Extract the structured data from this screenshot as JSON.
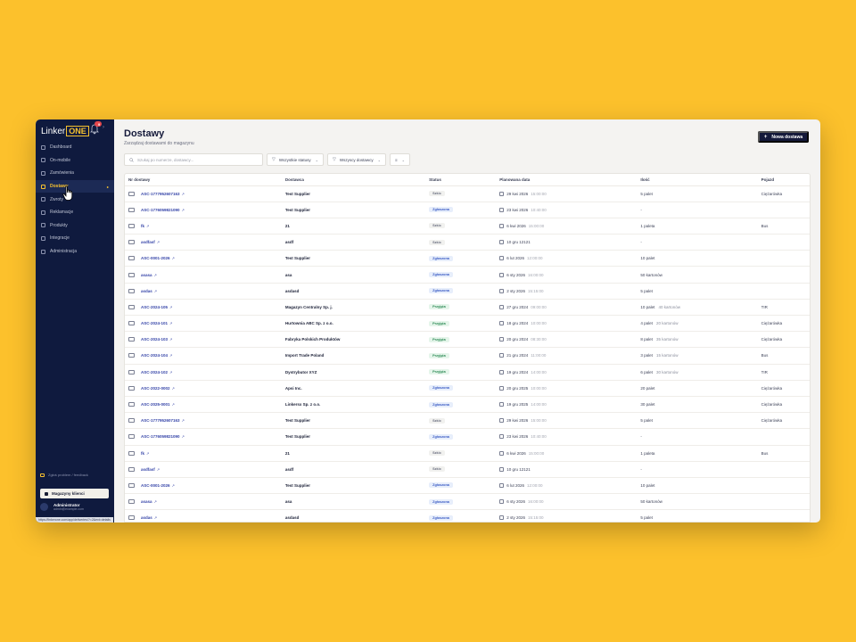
{
  "sidebar": {
    "logo_text": "Linker",
    "logo_box": "ONE",
    "notifications_count": "9",
    "nav": [
      {
        "label": "Dashboard",
        "icon": "grid-icon",
        "active": false
      },
      {
        "label": "On-mobile",
        "icon": "phone-icon",
        "active": false
      },
      {
        "label": "Zamówienia",
        "icon": "cart-icon",
        "active": false
      },
      {
        "label": "Dostawy",
        "icon": "truck-icon",
        "active": true
      },
      {
        "label": "Zwroty",
        "icon": "return-icon",
        "active": false
      },
      {
        "label": "Reklamacje",
        "icon": "alert-icon",
        "active": false
      },
      {
        "label": "Produkty",
        "icon": "box-icon",
        "active": false
      },
      {
        "label": "Integracje",
        "icon": "plug-icon",
        "active": false
      },
      {
        "label": "Administracja",
        "icon": "gear-icon",
        "active": false
      }
    ],
    "bottom_link": "Zgłoś problem / feedback",
    "warehouse_btn": "Magazyny klienci",
    "user_name": "Administrator",
    "user_email": "admin@example.com",
    "url_tooltip": "https://linkerone.com/app/deliveries/?=2&ext=details"
  },
  "header": {
    "title": "Dostawy",
    "subtitle": "Zarządzaj dostawami do magazynu",
    "new_button": "Nowa dostawa"
  },
  "filters": {
    "search_placeholder": "Szukaj po numerze, dostawcy...",
    "status_filter": "Wszystkie statusy",
    "supplier_filter": "Wszyscy dostawcy",
    "view_toggle": "≡"
  },
  "table": {
    "columns": [
      "Nr dostawy",
      "Dostawca",
      "Status",
      "Planowana data",
      "Ilość",
      "Pojazd"
    ],
    "rows": [
      {
        "id": "ASC-1777952607163",
        "supplier": "Test Supplier",
        "status": "Szkic",
        "status_type": "szkic",
        "date": "29 kwi 2026",
        "time": "15:00:00",
        "qty": "5 palet",
        "qty2": "",
        "vehicle": "Ciężarówka"
      },
      {
        "id": "ASC-1776059821090",
        "supplier": "Test Supplier",
        "status": "Zgłoszona",
        "status_type": "zgl",
        "date": "23 kwi 2026",
        "time": "10:40:00",
        "qty": "-",
        "qty2": "",
        "vehicle": ""
      },
      {
        "id": "fk",
        "supplier": "21",
        "status": "Szkic",
        "status_type": "szkic",
        "date": "6 kwi 2026",
        "time": "15:00:00",
        "qty": "1 paleta",
        "qty2": "",
        "vehicle": "Bus"
      },
      {
        "id": "asdfasf",
        "supplier": "asdf",
        "status": "Szkic",
        "status_type": "szkic",
        "date": "10 gru 12121",
        "time": "",
        "qty": "-",
        "qty2": "",
        "vehicle": ""
      },
      {
        "id": "ASC-0001-2026",
        "supplier": "Test Supplier",
        "status": "Zgłoszona",
        "status_type": "zgl",
        "date": "6 lut 2026",
        "time": "12:00:00",
        "qty": "10 palet",
        "qty2": "",
        "vehicle": ""
      },
      {
        "id": "asasa",
        "supplier": "asa",
        "status": "Zgłoszona",
        "status_type": "zgl",
        "date": "6 sty 2026",
        "time": "16:00:00",
        "qty": "50 kartonów",
        "qty2": "",
        "vehicle": ""
      },
      {
        "id": "asdas",
        "supplier": "asdasd",
        "status": "Zgłoszona",
        "status_type": "zgl",
        "date": "2 sty 2026",
        "time": "15:15:00",
        "qty": "5 palet",
        "qty2": "",
        "vehicle": ""
      },
      {
        "id": "ASC-2024-105",
        "supplier": "Magazyn Centralny Sp. j.",
        "status": "Przyjęta",
        "status_type": "przy",
        "date": "27 gru 2024",
        "time": "09:00:00",
        "qty": "10 palet",
        "qty2": "40 kartonów",
        "vehicle": "TIR"
      },
      {
        "id": "ASC-2024-101",
        "supplier": "Hurtownia ABC Sp. z o.o.",
        "status": "Przyjęta",
        "status_type": "przy",
        "date": "18 gru 2024",
        "time": "10:00:00",
        "qty": "4 palet",
        "qty2": "20 kartonów",
        "vehicle": "Ciężarówka"
      },
      {
        "id": "ASC-2024-103",
        "supplier": "Fabryka Polskich Produktów",
        "status": "Przyjęta",
        "status_type": "przy",
        "date": "20 gru 2024",
        "time": "08:30:00",
        "qty": "8 palet",
        "qty2": "35 kartonów",
        "vehicle": "Ciężarówka"
      },
      {
        "id": "ASC-2024-104",
        "supplier": "Import Trade Poland",
        "status": "Przyjęta",
        "status_type": "przy",
        "date": "21 gru 2024",
        "time": "11:00:00",
        "qty": "3 palet",
        "qty2": "15 kartonów",
        "vehicle": "Bus"
      },
      {
        "id": "ASC-2024-102",
        "supplier": "Dystrybutor XYZ",
        "status": "Przyjęta",
        "status_type": "przy",
        "date": "19 gru 2024",
        "time": "14:00:00",
        "qty": "6 palet",
        "qty2": "30 kartonów",
        "vehicle": "TIR"
      },
      {
        "id": "ASC-2022-0002",
        "supplier": "Apsi Inc.",
        "status": "Zgłoszona",
        "status_type": "zgl",
        "date": "20 gru 2025",
        "time": "10:00:00",
        "qty": "20 palet",
        "qty2": "",
        "vehicle": "Ciężarówka"
      },
      {
        "id": "ASC-2025-0001",
        "supplier": "Linkersx Sp. z o.o.",
        "status": "Zgłoszona",
        "status_type": "zgl",
        "date": "19 gru 2025",
        "time": "14:00:00",
        "qty": "30 palet",
        "qty2": "",
        "vehicle": "Ciężarówka"
      },
      {
        "id": "ASC-1777952607163",
        "supplier": "Test Supplier",
        "status": "Szkic",
        "status_type": "szkic",
        "date": "29 kwi 2026",
        "time": "15:00:00",
        "qty": "5 palet",
        "qty2": "",
        "vehicle": "Ciężarówka"
      },
      {
        "id": "ASC-1776059821090",
        "supplier": "Test Supplier",
        "status": "Zgłoszona",
        "status_type": "zgl",
        "date": "23 kwi 2026",
        "time": "10:40:00",
        "qty": "-",
        "qty2": "",
        "vehicle": ""
      },
      {
        "id": "fk",
        "supplier": "21",
        "status": "Szkic",
        "status_type": "szkic",
        "date": "6 kwi 2026",
        "time": "15:00:00",
        "qty": "1 paleta",
        "qty2": "",
        "vehicle": "Bus"
      },
      {
        "id": "asdfasf",
        "supplier": "asdf",
        "status": "Szkic",
        "status_type": "szkic",
        "date": "10 gru 12121",
        "time": "",
        "qty": "-",
        "qty2": "",
        "vehicle": ""
      },
      {
        "id": "ASC-0001-2026",
        "supplier": "Test Supplier",
        "status": "Zgłoszona",
        "status_type": "zgl",
        "date": "6 lut 2026",
        "time": "12:00:00",
        "qty": "10 palet",
        "qty2": "",
        "vehicle": ""
      },
      {
        "id": "asasa",
        "supplier": "asa",
        "status": "Zgłoszona",
        "status_type": "zgl",
        "date": "6 sty 2026",
        "time": "16:00:00",
        "qty": "50 kartonów",
        "qty2": "",
        "vehicle": ""
      },
      {
        "id": "asdas",
        "supplier": "asdasd",
        "status": "Zgłoszona",
        "status_type": "zgl",
        "date": "2 sty 2026",
        "time": "15:15:00",
        "qty": "5 palet",
        "qty2": "",
        "vehicle": ""
      }
    ]
  },
  "colors": {
    "background": "#FCC12C",
    "sidebar": "#0F1A3E",
    "accent": "#F6C12F",
    "link": "#3544A8"
  }
}
